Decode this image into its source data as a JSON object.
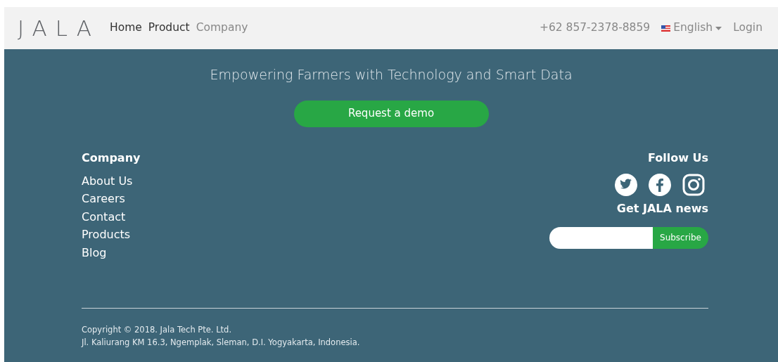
{
  "navbar": {
    "logo": "JALA",
    "links": [
      {
        "label": "Home",
        "dimmed": false
      },
      {
        "label": "Product",
        "dimmed": false
      },
      {
        "label": "Company",
        "dimmed": true
      }
    ],
    "phone": "+62 857-2378-8859",
    "language": "English",
    "login": "Login"
  },
  "hero": {
    "tagline": "Empowering Farmers with Technology and Smart Data",
    "button": "Request a demo"
  },
  "footer": {
    "company": {
      "heading": "Company",
      "links": [
        "About Us",
        "Careers",
        "Contact",
        "Products",
        "Blog"
      ]
    },
    "follow": {
      "heading": "Follow Us",
      "socials": [
        {
          "kind": "twitter"
        },
        {
          "kind": "facebook"
        },
        {
          "kind": "instagram"
        }
      ],
      "news_heading": "Get JALA news",
      "subscribe": "Subscribe"
    },
    "copyright": "Copyright © 2018. Jala Tech Pte. Ltd.",
    "address": "Jl. Kaliurang KM 16.3, Ngemplak, Sleman, D.I. Yogyakarta, Indonesia."
  }
}
